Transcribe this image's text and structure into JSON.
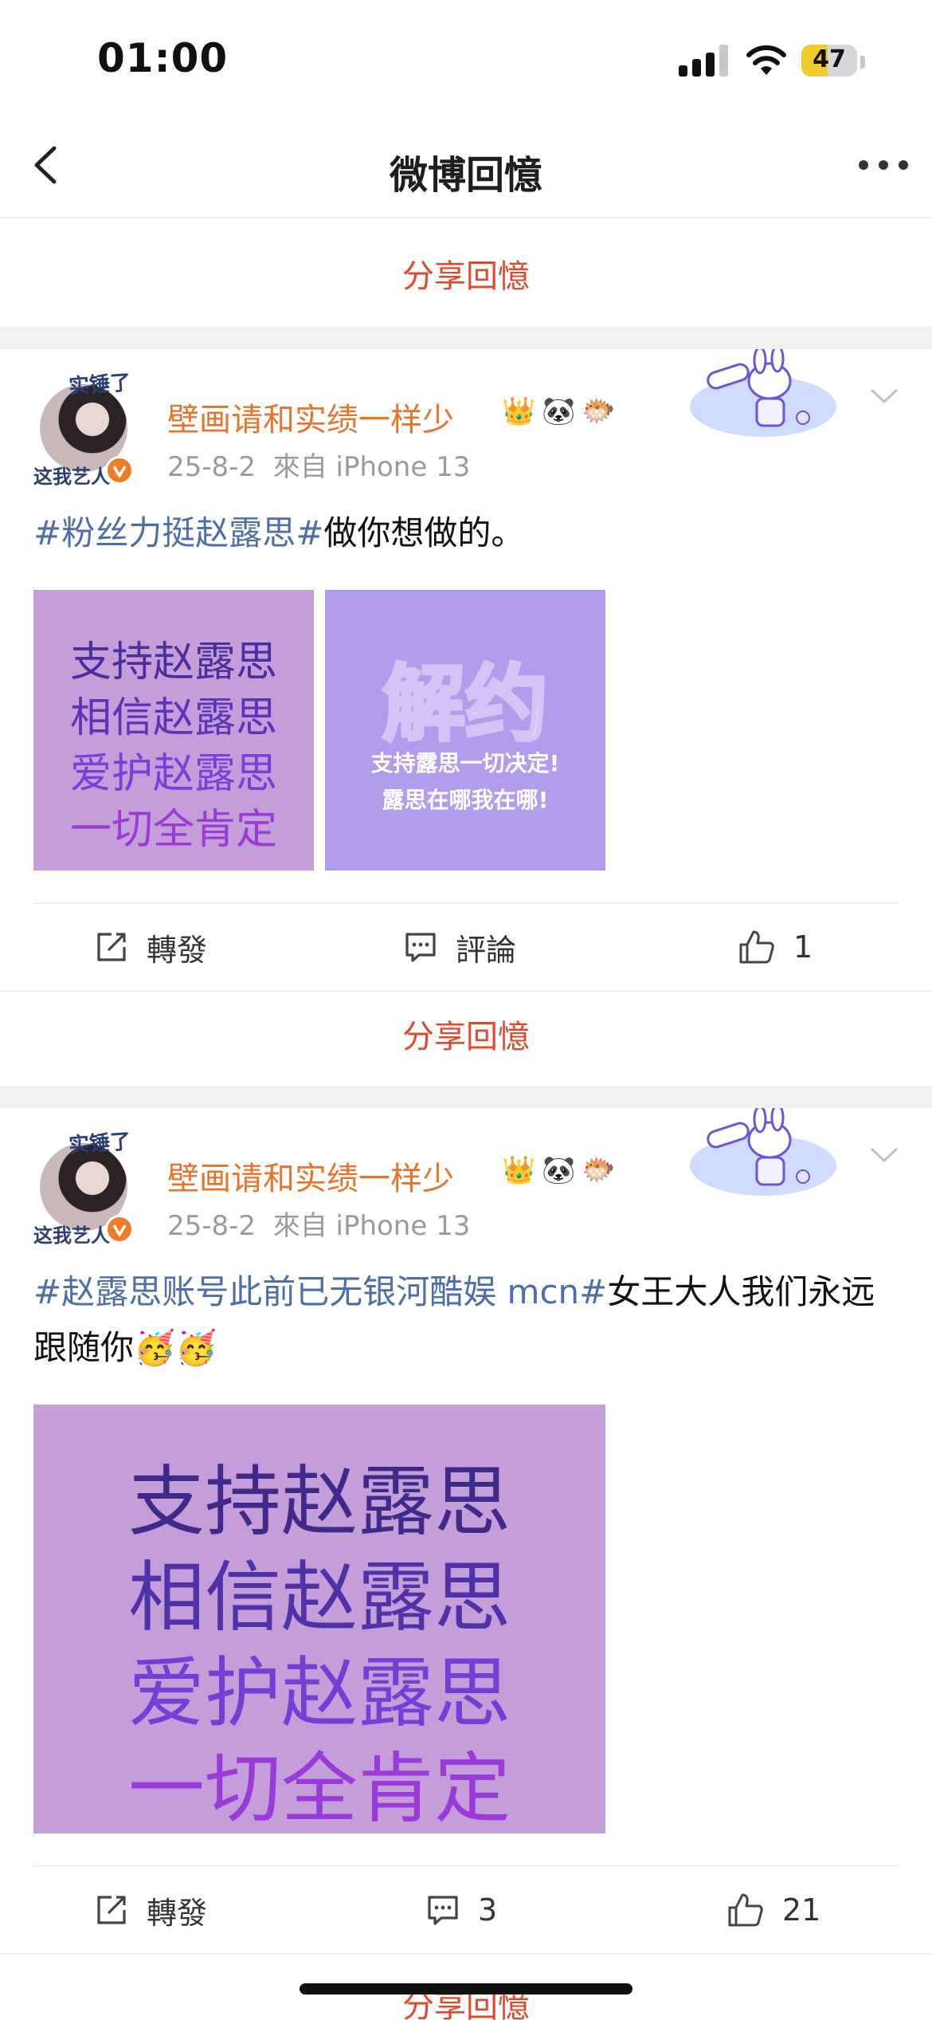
{
  "status_bar": {
    "time": "01:00",
    "battery": "47",
    "battery_level": 0.47,
    "signal_bars": 4,
    "signal_active": 3
  },
  "nav": {
    "title": "微博回憶"
  },
  "share_label": "分享回憶",
  "posts": [
    {
      "avatar_top": "实锤了",
      "avatar_bottom": "这我艺人",
      "username": "壁画请和实绩一样少",
      "badges": [
        "👑",
        "🐼",
        "🐡"
      ],
      "date": "25-8-2",
      "source": "來自 iPhone 13",
      "hashtag": "#粉丝力挺赵露思#",
      "text": "做你想做的。",
      "images": [
        {
          "lines": [
            "支持赵露思",
            "相信赵露思",
            "爱护赵露思",
            "一切全肯定"
          ],
          "colors": [
            "#4a2f9c",
            "#5a35b8",
            "#7a3fd8",
            "#9b3ad6"
          ]
        },
        {
          "title": "解约",
          "lines": [
            "支持露思一切决定!",
            "露思在哪我在哪!"
          ]
        }
      ],
      "actions": {
        "repost": "轉發",
        "comment": "評論",
        "like": "1"
      }
    },
    {
      "avatar_top": "实锤了",
      "avatar_bottom": "这我艺人",
      "username": "壁画请和实绩一样少",
      "badges": [
        "👑",
        "🐼",
        "🐡"
      ],
      "date": "25-8-2",
      "source": "來自 iPhone 13",
      "hashtag": "#赵露思账号此前已无银河酷娱 mcn#",
      "text": "女王大人我们永远跟随你",
      "emojis": [
        "🥳",
        "🥳"
      ],
      "images": [
        {
          "lines": [
            "支持赵露思",
            "相信赵露思",
            "爱护赵露思",
            "一切全肯定"
          ],
          "colors": [
            "#3f2a8a",
            "#4f31a8",
            "#7240d4",
            "#9a3ad8"
          ]
        }
      ],
      "actions": {
        "repost": "轉發",
        "comment": "3",
        "like": "21"
      }
    }
  ]
}
